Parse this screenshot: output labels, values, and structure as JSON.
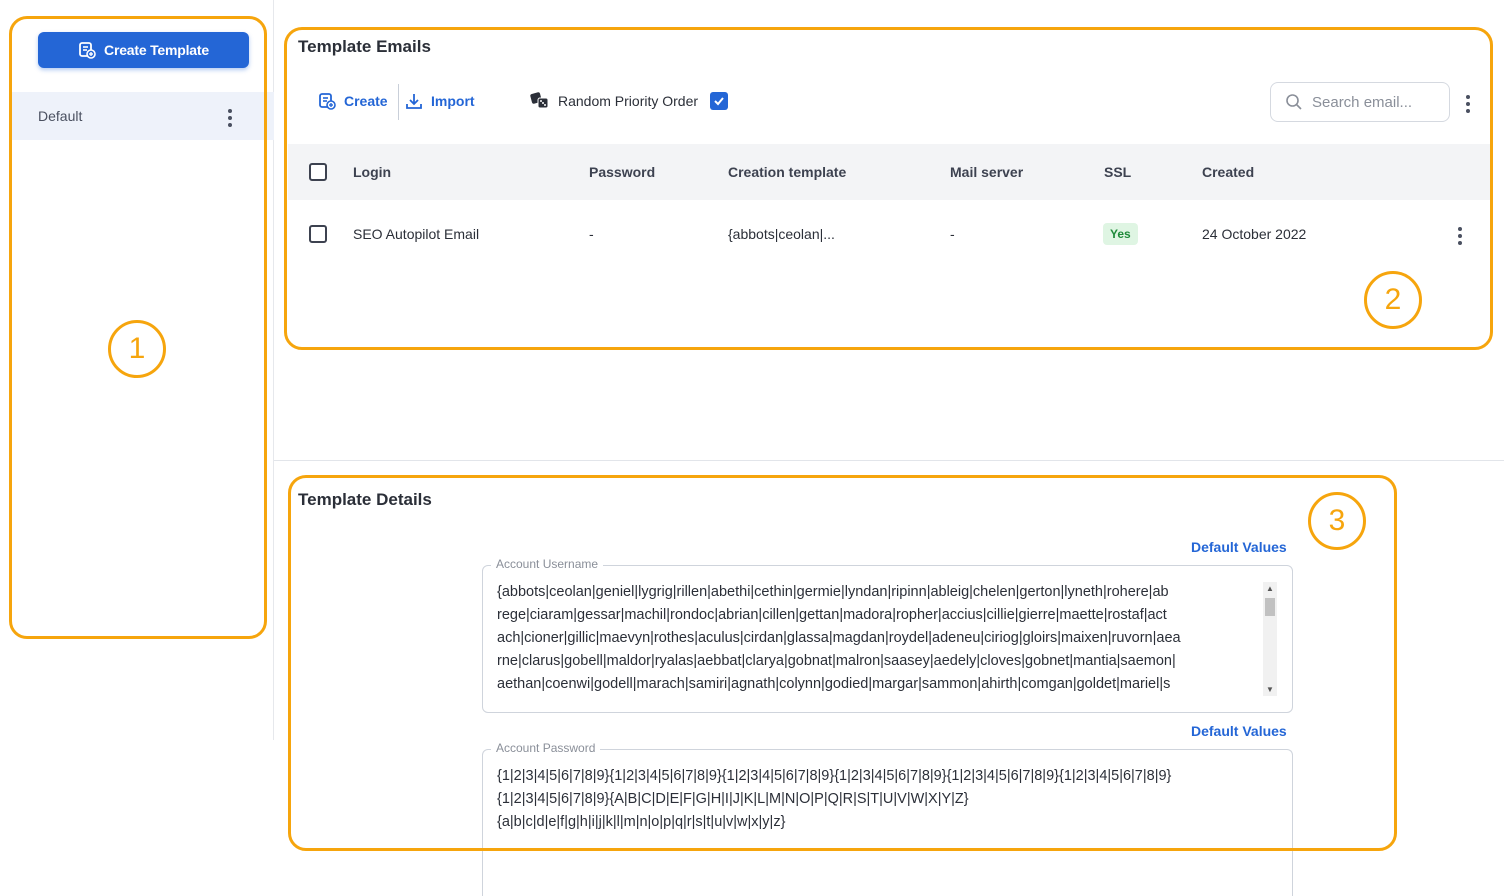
{
  "sidebar": {
    "create_button_label": "Create Template",
    "items": [
      {
        "label": "Default"
      }
    ]
  },
  "emails": {
    "title": "Template Emails",
    "toolbar": {
      "create_label": "Create",
      "import_label": "Import",
      "random_priority_label": "Random Priority Order",
      "random_priority_checked": true
    },
    "search": {
      "placeholder": "Search email..."
    },
    "columns": [
      "Login",
      "Password",
      "Creation template",
      "Mail server",
      "SSL",
      "Created"
    ],
    "rows": [
      {
        "login": "SEO Autopilot Email",
        "password": "-",
        "creation_template": "{abbots|ceolan|...",
        "mail_server": "-",
        "ssl": "Yes",
        "created": "24 October 2022"
      }
    ]
  },
  "details": {
    "title": "Template Details",
    "username": {
      "legend": "Account Username",
      "default_values_label": "Default Values",
      "lines": [
        "{abbots|ceolan|geniel|lygrig|rillen|abethi|cethin|germie|lyndan|ripinn|ableig|chelen|gerton|lyneth|rohere|ab",
        "rege|ciaram|gessar|machil|rondoc|abrian|cillen|gettan|madora|ropher|accius|cillie|gierre|maette|rostaf|act",
        "ach|cioner|gillic|maevyn|rothes|aculus|cirdan|glassa|magdan|roydel|adeneu|ciriog|gloirs|maixen|ruvorn|aea",
        "rne|clarus|gobell|maldor|ryalas|aebbat|clarya|gobnat|malron|saasey|aedely|cloves|gobnet|mantia|saemon|",
        "aethan|coenwi|godell|marach|samiri|agnath|colynn|godied|margar|sammon|ahirth|comgan|goldet|mariel|s"
      ]
    },
    "password": {
      "legend": "Account Password",
      "default_values_label": "Default Values",
      "lines": [
        "{1|2|3|4|5|6|7|8|9}{1|2|3|4|5|6|7|8|9}{1|2|3|4|5|6|7|8|9}{1|2|3|4|5|6|7|8|9}{1|2|3|4|5|6|7|8|9}{1|2|3|4|5|6|7|8|9}",
        "{1|2|3|4|5|6|7|8|9}{A|B|C|D|E|F|G|H|I|J|K|L|M|N|O|P|Q|R|S|T|U|V|W|X|Y|Z}",
        "{a|b|c|d|e|f|g|h|i|j|k|l|m|n|o|p|q|r|s|t|u|v|w|x|y|z}"
      ]
    }
  },
  "callouts": [
    "1",
    "2",
    "3"
  ],
  "colors": {
    "accent": "#2466d6",
    "callout": "#f6a50d",
    "ssl_bg": "#dff5e3",
    "ssl_text": "#1f8b3a"
  }
}
